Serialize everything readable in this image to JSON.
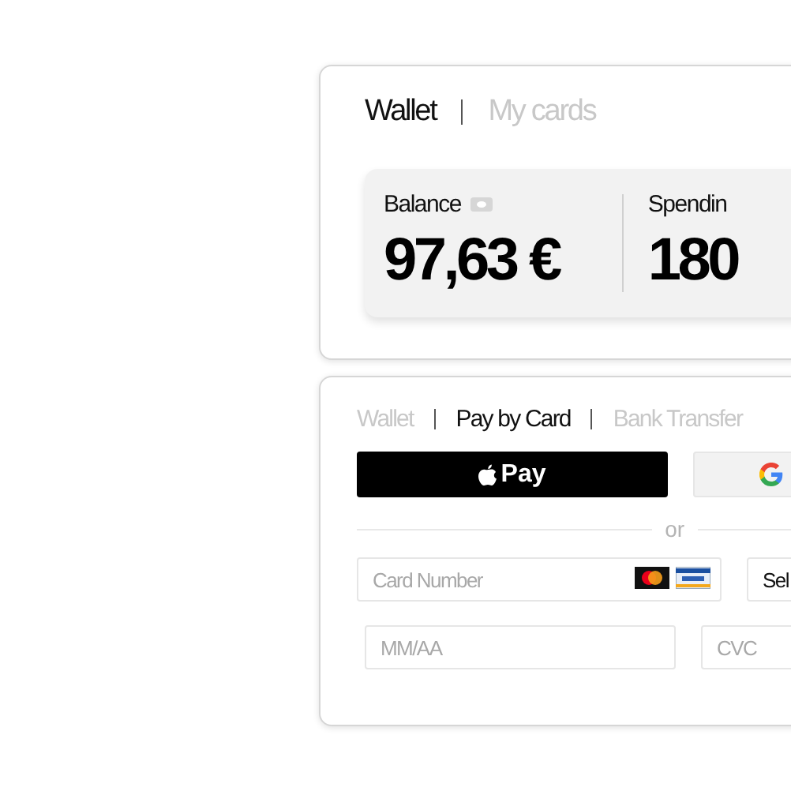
{
  "wallet_card": {
    "tabs": [
      {
        "label": "Wallet",
        "selected": true
      },
      {
        "label": "My cards",
        "selected": false
      }
    ],
    "stats": [
      {
        "label": "Balance",
        "value": "97,63 €",
        "hidden_toggle": true
      },
      {
        "label": "Spendin",
        "value": "180",
        "hidden_toggle": false
      }
    ]
  },
  "payment_card": {
    "tabs": [
      {
        "label": "Wallet",
        "selected": false
      },
      {
        "label": "Pay by Card",
        "selected": true
      },
      {
        "label": "Bank Transfer",
        "selected": false
      }
    ],
    "apple_pay_label": "Pay",
    "separator": "or",
    "fields": [
      {
        "placeholder": "Card Number",
        "kind": "card"
      },
      {
        "value": "Sel",
        "kind": "select"
      },
      {
        "placeholder": "MM/AA",
        "kind": "plain"
      },
      {
        "placeholder": "CVC",
        "kind": "plain"
      }
    ]
  }
}
